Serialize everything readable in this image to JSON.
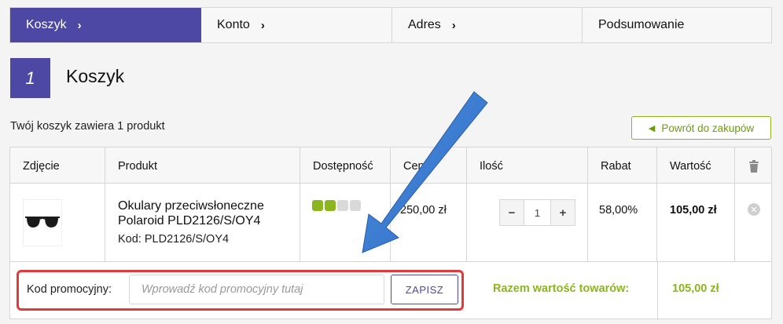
{
  "steps": [
    {
      "label": "Koszyk",
      "chevron": "›"
    },
    {
      "label": "Konto",
      "chevron": "›"
    },
    {
      "label": "Adres",
      "chevron": "›"
    },
    {
      "label": "Podsumowanie"
    }
  ],
  "heading": {
    "number": "1",
    "title": "Koszyk"
  },
  "summary": {
    "count_text": "Twój koszyk zawiera 1 produkt",
    "back_label": "Powrót do zakupów",
    "back_icon": "arrow-left-icon"
  },
  "table": {
    "headers": [
      "Zdjęcie",
      "Produkt",
      "Dostępność",
      "Cena",
      "Ilość",
      "Rabat",
      "Wartość"
    ],
    "item": {
      "name": "Okulary przeciwsłoneczne Polaroid PLD2126/S/OY4",
      "code": "Kod: PLD2126/S/OY4",
      "availability_level": 2,
      "availability_max": 4,
      "price": "250,00 zł",
      "quantity": "1",
      "discount": "58,00%",
      "total": "105,00 zł",
      "qty_minus": "−",
      "qty_plus": "+"
    }
  },
  "promo": {
    "label": "Kod promocyjny:",
    "placeholder": "Wprowadź kod promocyjny tutaj",
    "value": "",
    "button": "ZAPISZ"
  },
  "totals": {
    "label": "Razem wartość towarów:",
    "value": "105,00 zł"
  },
  "colors": {
    "accent": "#4c48a3",
    "green": "#8cb51e",
    "highlight": "#e03a3a",
    "arrow": "#3a7bd5"
  }
}
